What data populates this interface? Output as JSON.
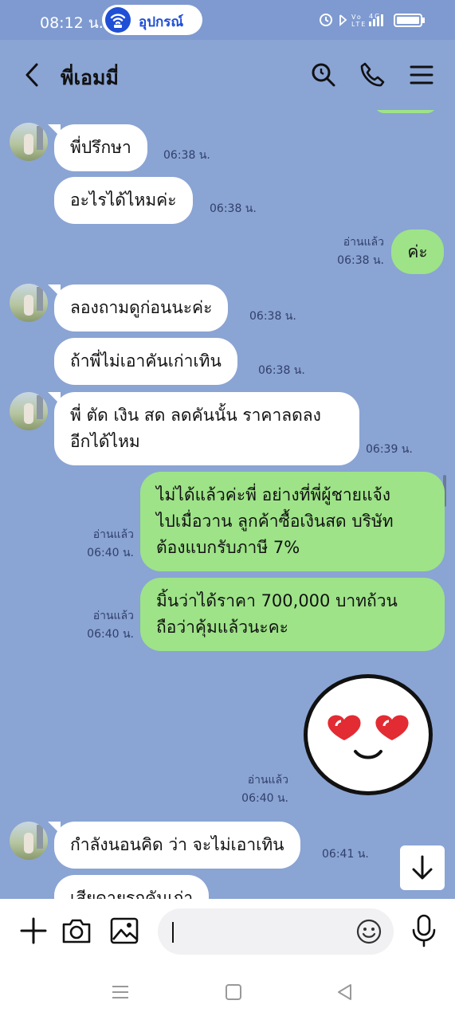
{
  "status_bar": {
    "time": "08:12 น.",
    "pill_label": "อุปกรณ์",
    "right_icons_text": "⏰ ✱ Vo LTE ⁴ᴳ ▮▮▮"
  },
  "header": {
    "title": "พี่เอมมี่"
  },
  "messages": [
    {
      "dir": "in",
      "text": "พี่ปรึกษา",
      "time": "06:38 น."
    },
    {
      "dir": "in",
      "text": "อะไรได้ไหมค่ะ",
      "time": "06:38 น."
    },
    {
      "dir": "out",
      "text": "ค่ะ",
      "read": "อ่านแล้ว",
      "time": "06:38 น."
    },
    {
      "dir": "in",
      "text": "ลองถามดูก่อนนะค่ะ",
      "time": "06:38 น."
    },
    {
      "dir": "in",
      "text": "ถ้าพี่ไม่เอาคันเก่าเทิน",
      "time": "06:38 น."
    },
    {
      "dir": "in",
      "text": "พี่ ตัด เงิน สด ลดคันนั้น ราคาลดลง\nอีกได้ไหม",
      "time": "06:39 น."
    },
    {
      "dir": "out",
      "text": "ไม่ได้แล้วค่ะพี่ อย่างที่พี่ผู้ชายแจ้ง\nไปเมื่อวาน ลูกค้าซื้อเงินสด บริษัท\nต้องแบกรับภาษี 7%",
      "read": "อ่านแล้ว",
      "time": "06:40 น."
    },
    {
      "dir": "out",
      "text": "มิ้นว่าได้ราคา 700,000 บาทถ้วน\nถือว่าคุ้มแล้วนะคะ",
      "read": "อ่านแล้ว",
      "time": "06:40 น."
    },
    {
      "dir": "out",
      "sticker": "heart-eyes-smiley",
      "read": "อ่านแล้ว",
      "time": "06:40 น."
    },
    {
      "dir": "in",
      "text": "กำลังนอนคิด ว่า จะไม่เอาเทิน",
      "time": "06:41 น."
    },
    {
      "dir": "in",
      "text": "เสียดายรถคันเก่า",
      "time": ""
    }
  ],
  "icons": {
    "back": "chevron-left-icon",
    "search": "search-icon",
    "call": "phone-icon",
    "menu": "menu-icon",
    "add": "plus-icon",
    "camera": "camera-icon",
    "gallery": "image-icon",
    "emoji": "emoji-icon",
    "mic": "mic-icon",
    "scroll_down": "arrow-down-icon"
  },
  "colors": {
    "chat_bg": "#8aa4d4",
    "outgoing_bubble": "#9ee388",
    "incoming_bubble": "#ffffff",
    "brand": "#1f4fd6"
  }
}
